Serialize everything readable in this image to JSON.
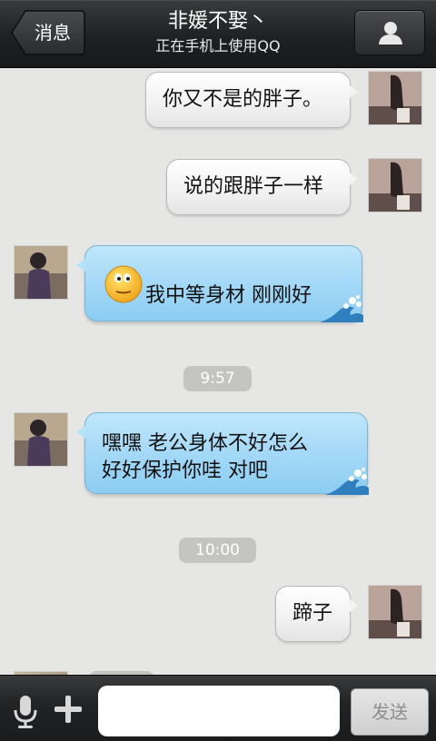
{
  "header": {
    "back_label": "消息",
    "title": "非媛不娶丶",
    "subtitle": "正在手机上使用QQ"
  },
  "messages": [
    {
      "side": "out",
      "text": "你又不是的胖子。"
    },
    {
      "side": "out",
      "text": "说的跟胖子一样"
    },
    {
      "side": "in",
      "text": "我中等身材  刚刚好",
      "emoji": "smiley-face-icon"
    },
    {
      "type": "time",
      "text": "9:57"
    },
    {
      "side": "in",
      "lines": [
        "嘿嘿  老公身体不好怎么",
        "好好保护你哇  对吧"
      ]
    },
    {
      "type": "time",
      "text": "10:00"
    },
    {
      "side": "out",
      "text": "蹄子"
    }
  ],
  "composer": {
    "input_value": "",
    "send_label": "发送"
  },
  "colors": {
    "header_bg": "#1f2022",
    "chat_bg": "#e6e7e5",
    "bubble_in": "#a6daf7",
    "bubble_out": "#f1f1f1",
    "time_pill": "#c4c5c3"
  }
}
